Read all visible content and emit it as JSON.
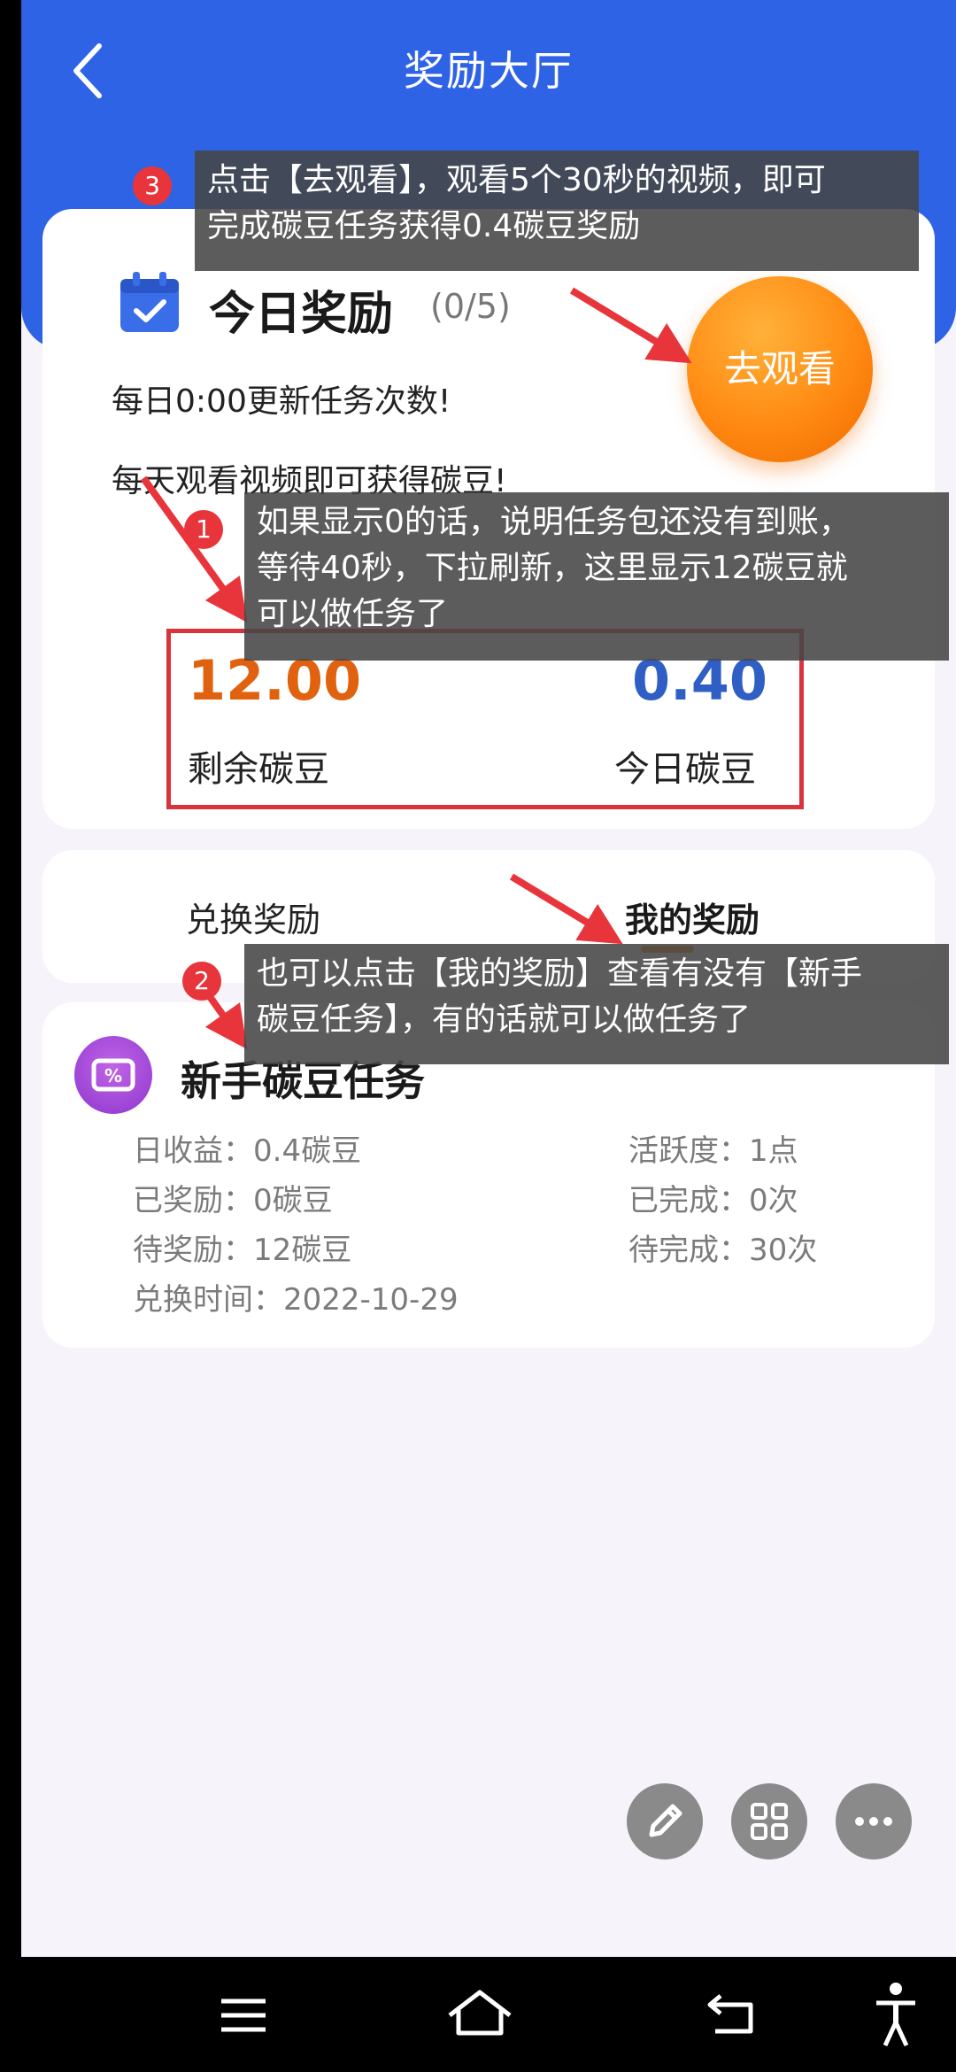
{
  "header": {
    "title": "奖励大厅"
  },
  "today_reward": {
    "title": "今日奖励",
    "count": "(0/5)",
    "line1": "每日0:00更新任务次数!",
    "line2": "每天观看视频即可获得碳豆!",
    "watch_button": "去观看"
  },
  "stats": {
    "remaining_value": "12.00",
    "remaining_label": "剩余碳豆",
    "today_value": "0.40",
    "today_label": "今日碳豆"
  },
  "tabs": {
    "exchange": "兑换奖励",
    "mine": "我的奖励"
  },
  "task": {
    "title": "新手碳豆任务",
    "left": [
      "日收益：0.4碳豆",
      "已奖励：0碳豆",
      "待奖励：12碳豆",
      "兑换时间：2022-10-29"
    ],
    "right": [
      "活跃度：1点",
      "已完成：0次",
      "待完成：30次"
    ]
  },
  "annotations": {
    "badge1": "1",
    "badge2": "2",
    "badge3": "3",
    "note3_line1": "点击【去观看】，观看5个30秒的视频，即可",
    "note3_line2": "完成碳豆任务获得0.4碳豆奖励",
    "note1_line1": "如果显示0的话，说明任务包还没有到账，",
    "note1_line2": "等待40秒，下拉刷新，这里显示12碳豆就",
    "note1_line3": "可以做任务了",
    "note2_line1": "也可以点击【我的奖励】查看有没有【新手",
    "note2_line2": "碳豆任务】，有的话就可以做任务了"
  },
  "colors": {
    "header_blue": "#2f63e6",
    "orange": "#ff8a12",
    "red_annotation": "#d8343b",
    "blue_value": "#2f5fc4"
  },
  "icons": [
    "back-arrow-icon",
    "calendar-check-icon",
    "ticket-icon",
    "pencil-icon",
    "grid-icon",
    "more-icon",
    "menu-icon",
    "home-icon",
    "back-icon",
    "accessibility-icon"
  ]
}
